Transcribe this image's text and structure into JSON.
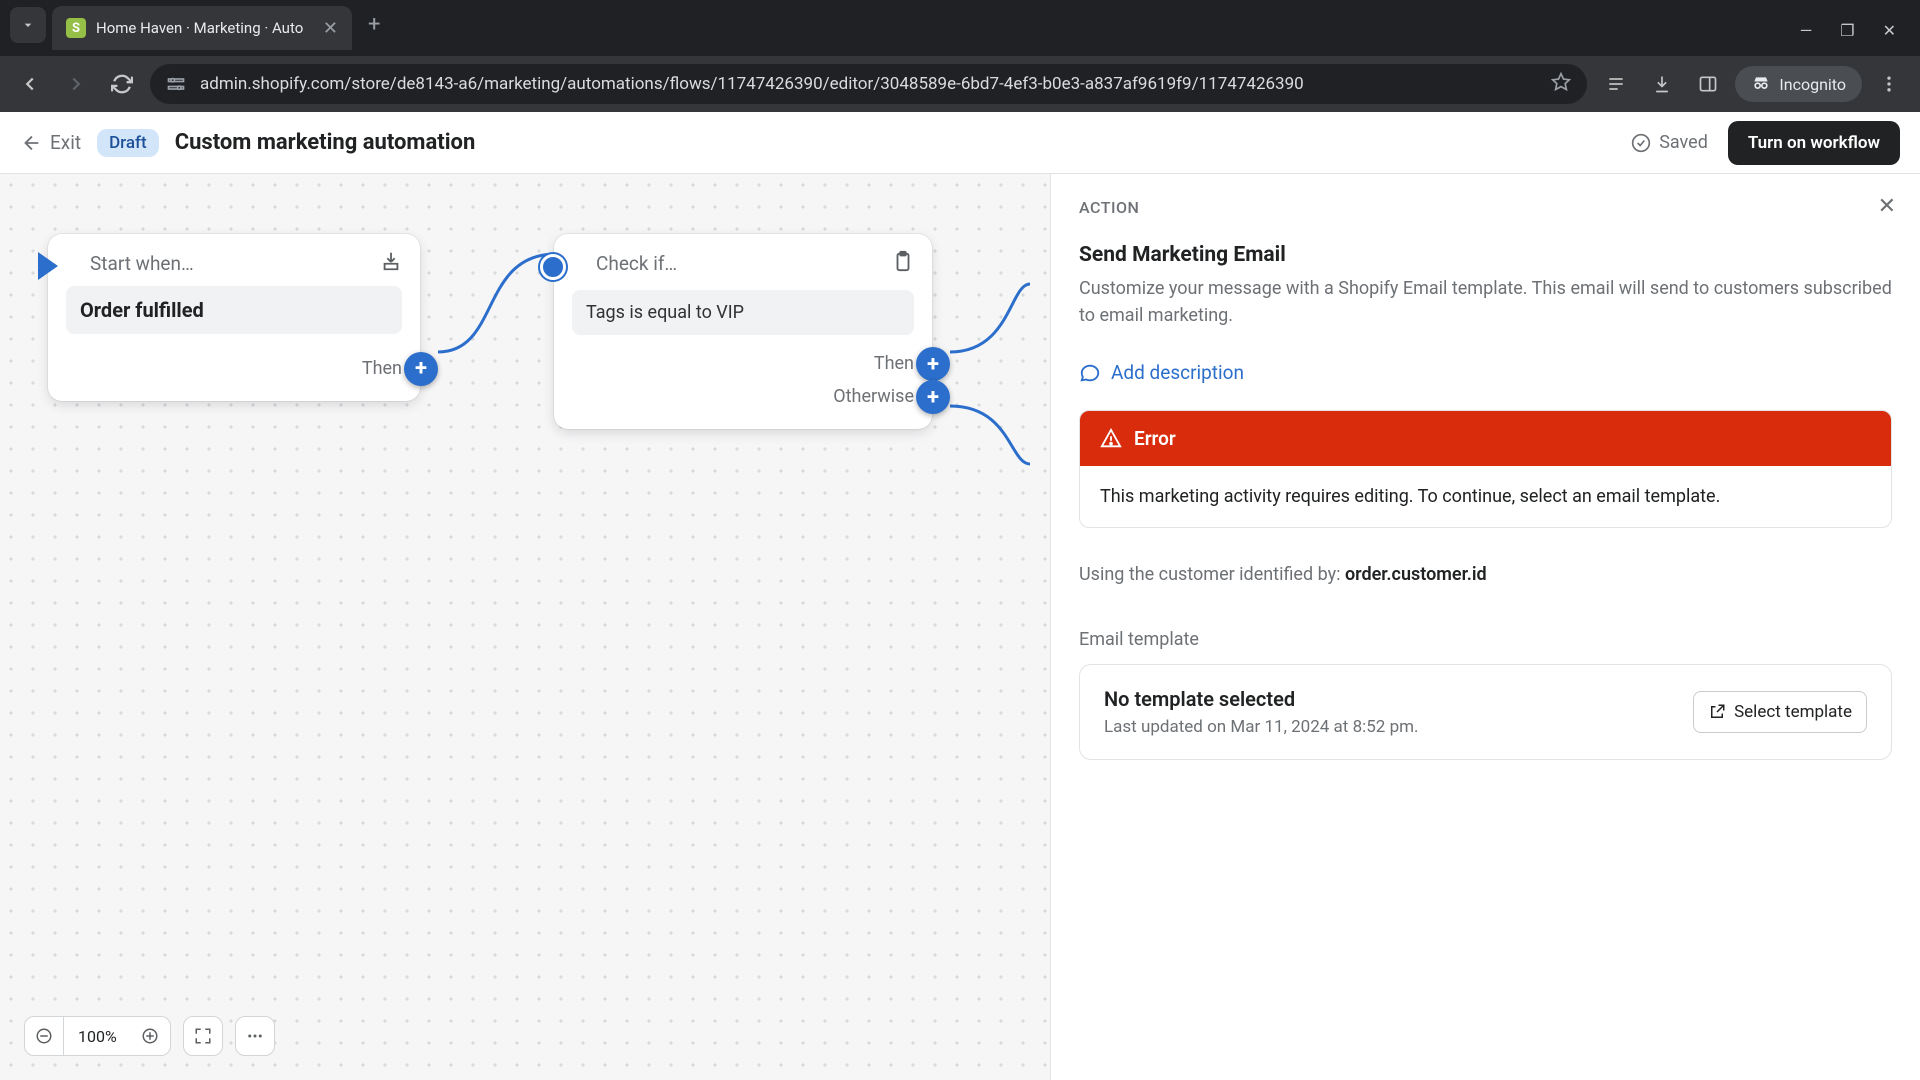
{
  "browser": {
    "tab_title": "Home Haven · Marketing · Auto",
    "url": "admin.shopify.com/store/de8143-a6/marketing/automations/flows/11747426390/editor/3048589e-6bd7-4ef3-b0e3-a837af9619f9/11747426390",
    "incognito_label": "Incognito"
  },
  "header": {
    "exit": "Exit",
    "draft": "Draft",
    "title": "Custom marketing automation",
    "saved": "Saved",
    "turn_on": "Turn on workflow"
  },
  "canvas": {
    "start_node": {
      "title": "Start when…",
      "condition": "Order fulfilled",
      "then": "Then"
    },
    "check_node": {
      "title": "Check if…",
      "condition": "Tags is equal to VIP",
      "then": "Then",
      "otherwise": "Otherwise"
    },
    "zoom": "100%"
  },
  "sidebar": {
    "label": "ACTION",
    "title": "Send Marketing Email",
    "description": "Customize your message with a Shopify Email template. This email will send to customers subscribed to email marketing.",
    "add_description": "Add description",
    "error": {
      "title": "Error",
      "body": "This marketing activity requires editing. To continue, select an email template."
    },
    "identifier_prefix": "Using the customer identified by: ",
    "identifier_value": "order.customer.id",
    "email_template_label": "Email template",
    "template": {
      "title": "No template selected",
      "subtitle": "Last updated on Mar 11, 2024 at 8:52 pm.",
      "select_button": "Select template"
    }
  }
}
